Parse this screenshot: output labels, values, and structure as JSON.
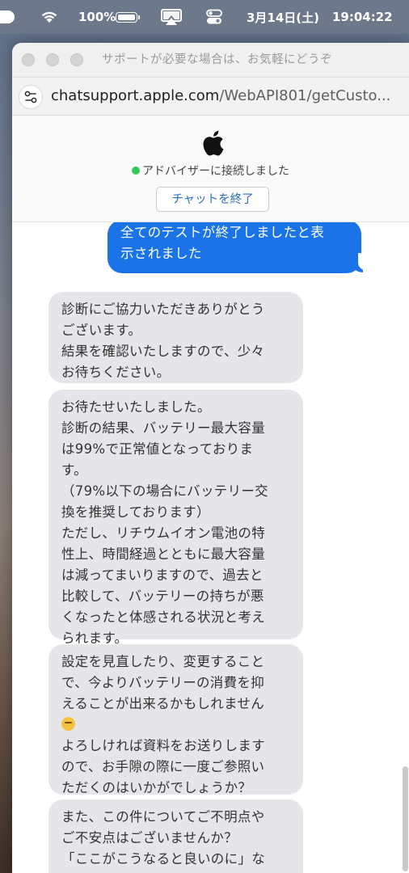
{
  "menubar": {
    "battery_percent": "100%",
    "date": "3月14日(土)",
    "time": "19:04:22"
  },
  "window": {
    "title": "サポートが必要な場合は、お気軽にどうぞ",
    "url_domain": "chatsupport.apple.com",
    "url_path": "/WebAPI801/getCusto..."
  },
  "chat_header": {
    "logo_icon": "apple-logo-icon",
    "status_text": "アドバイザーに接続しました",
    "status_color": "#34c759",
    "end_chat_label": "チャットを終了"
  },
  "messages": [
    {
      "from": "user",
      "text": "全てのテストが終了しましたと表\n示されました"
    },
    {
      "from": "agent",
      "text": "診断にご協力いただきありがとう\nございます。\n結果を確認いたしますので、少々\nお待ちください。"
    },
    {
      "from": "agent",
      "text": "お待たせいたしました。\n診断の結果、バッテリー最大容量\nは99%で正常値となっておりま\nす。\n（79%以下の場合にバッテリー交\n換を推奨しております）\nただし、リチウムイオン電池の特\n性上、時間経過とともに最大容量\nは減ってまいりますので、過去と\n比較して、バッテリーの持ちが悪\nくなったと体感される状況と考え\nられます。"
    },
    {
      "from": "agent",
      "text_before": "設定を見直したり、変更すること\nで、今よりバッテリーの消費を抑\nえることが出来るかもしれません\n",
      "emoji": "thinking-face-icon",
      "text_after": "\nよろしければ資料をお送りします\nので、お手隙の際に一度ご参照い\nただくのはいかがでしょうか？"
    },
    {
      "from": "agent",
      "text": "また、この件についてご不明点や\nご不安点はございませんか？\n「ここがこうなると良いのに」な"
    }
  ],
  "colors": {
    "user_bubble": "#1a74e8",
    "agent_bubble": "#e6e6ea"
  }
}
